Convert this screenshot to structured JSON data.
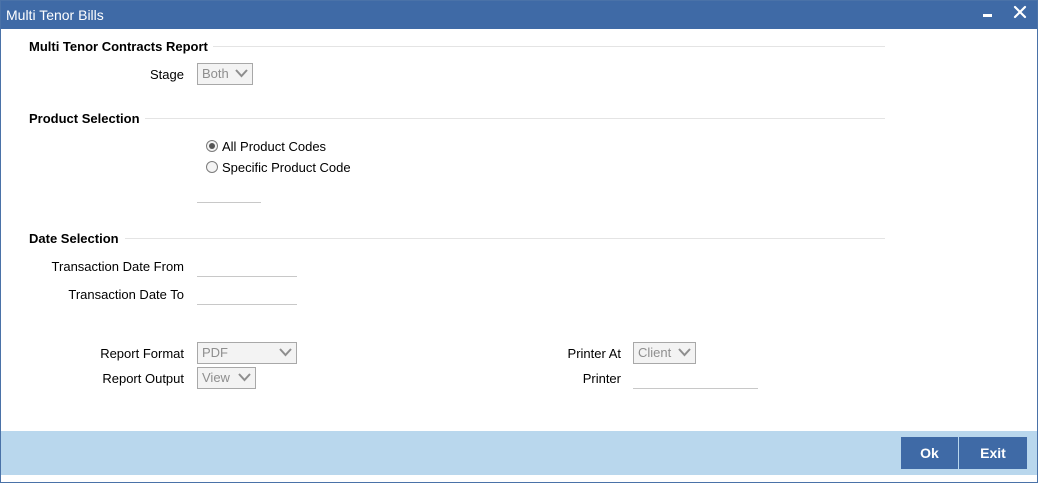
{
  "window": {
    "title": "Multi Tenor Bills"
  },
  "sections": {
    "report": "Multi Tenor Contracts Report",
    "product": "Product Selection",
    "date": "Date Selection"
  },
  "stage": {
    "label": "Stage",
    "value": "Both"
  },
  "product": {
    "options": [
      {
        "label": "All Product Codes",
        "selected": true
      },
      {
        "label": "Specific Product Code",
        "selected": false
      }
    ],
    "code_value": ""
  },
  "dates": {
    "from_label": "Transaction Date From",
    "from_value": "",
    "to_label": "Transaction Date To",
    "to_value": ""
  },
  "report": {
    "format_label": "Report Format",
    "format_value": "PDF",
    "output_label": "Report Output",
    "output_value": "View",
    "printer_at_label": "Printer At",
    "printer_at_value": "Client",
    "printer_label": "Printer",
    "printer_value": ""
  },
  "buttons": {
    "ok": "Ok",
    "exit": "Exit"
  },
  "colors": {
    "titlebar": "#3f6aa6",
    "footer": "#b9d7ed",
    "button": "#3f6aa6"
  },
  "icons": {
    "minimize": "minimize-icon",
    "close": "close-icon",
    "dropdown": "chevron-down-icon"
  }
}
